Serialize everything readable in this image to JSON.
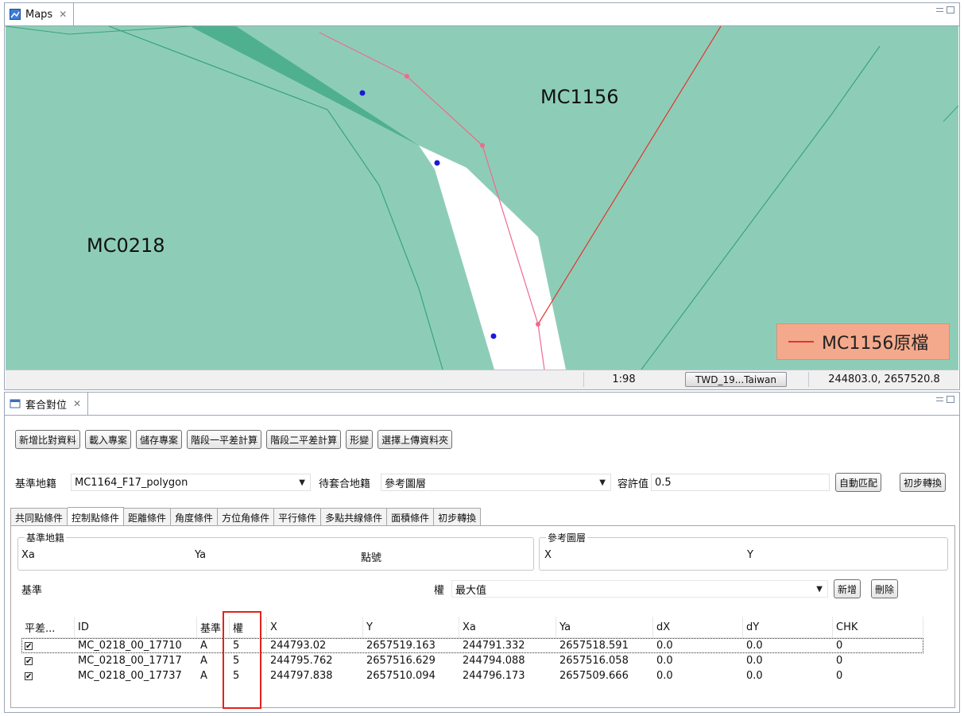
{
  "map_panel": {
    "tab_title": "Maps",
    "labels": {
      "parcel_a": "MC1156",
      "parcel_b": "MC0218"
    },
    "legend": {
      "text": "MC1156原檔",
      "line_color": "#e3342c",
      "bg": "#f5a98c"
    },
    "status": {
      "scale": "1:98",
      "crs": "TWD_19...Taiwan",
      "coords": "244803.0, 2657520.8"
    },
    "colors": {
      "land": "#8dcdb7",
      "dark_polygon": "#4fb08f",
      "road": "#ffffff",
      "boundary": "#3aa37d",
      "pink_line": "#f06a8d",
      "vertex": "#1a1ad6"
    }
  },
  "fit_panel": {
    "tab_title": "套合對位",
    "toolbar": [
      "新增比對資料",
      "載入專案",
      "儲存專案",
      "階段一平差計算",
      "階段二平差計算",
      "形變",
      "選擇上傳資料夾"
    ],
    "base_label": "基準地籍",
    "base_value": "MC1164_F17_polygon",
    "target_label": "待套合地籍",
    "target_value": "參考圖層",
    "tolerance_label": "容許值",
    "tolerance_value": "0.5",
    "auto_match": "自動匹配",
    "initial_transform": "初步轉換",
    "tabs": [
      "共同點條件",
      "控制點條件",
      "距離條件",
      "角度條件",
      "方位角條件",
      "平行條件",
      "多點共線條件",
      "面積條件",
      "初步轉換"
    ],
    "active_tab": 1,
    "group_base": {
      "title": "基準地籍",
      "cols": [
        "Xa",
        "Ya",
        "點號"
      ]
    },
    "group_ref": {
      "title": "參考圖層",
      "cols": [
        "X",
        "Y"
      ]
    },
    "basis_label": "基準",
    "weight_label": "權",
    "weight_value": "最大值",
    "add_label": "新增",
    "delete_label": "刪除",
    "table": {
      "headers": [
        "平差...",
        "ID",
        "基準",
        "權",
        "X",
        "Y",
        "Xa",
        "Ya",
        "dX",
        "dY",
        "CHK"
      ],
      "rows": [
        {
          "checked": "✔",
          "id": "MC_0218_00_17710",
          "basis": "A",
          "weight": "5",
          "x": "244793.02",
          "y": "2657519.163",
          "xa": "244791.332",
          "ya": "2657518.591",
          "dx": "0.0",
          "dy": "0.0",
          "chk": "0"
        },
        {
          "checked": "✔",
          "id": "MC_0218_00_17717",
          "basis": "A",
          "weight": "5",
          "x": "244795.762",
          "y": "2657516.629",
          "xa": "244794.088",
          "ya": "2657516.058",
          "dx": "0.0",
          "dy": "0.0",
          "chk": "0"
        },
        {
          "checked": "✔",
          "id": "MC_0218_00_17737",
          "basis": "A",
          "weight": "5",
          "x": "244797.838",
          "y": "2657510.094",
          "xa": "244796.173",
          "ya": "2657509.666",
          "dx": "0.0",
          "dy": "0.0",
          "chk": "0"
        }
      ]
    },
    "highlight_color": "#e2231a"
  }
}
